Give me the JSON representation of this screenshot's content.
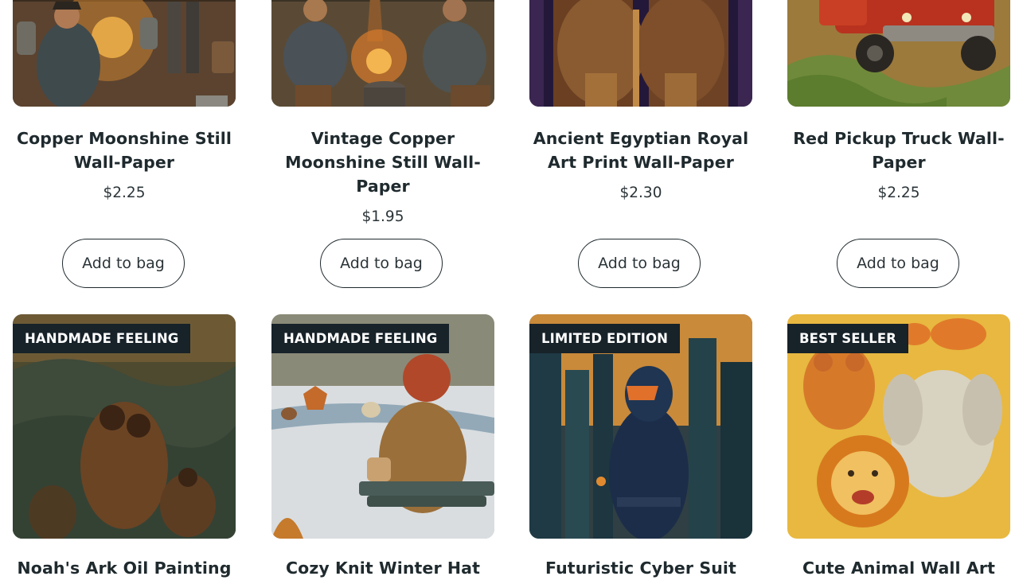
{
  "products_row1": [
    {
      "title": "Copper Moonshine Still Wall-Paper",
      "price": "$2.25",
      "button": "Add to bag"
    },
    {
      "title": "Vintage Copper Moonshine Still Wall-Paper",
      "price": "$1.95",
      "button": "Add to bag"
    },
    {
      "title": "Ancient Egyptian Royal Art Print Wall-Paper",
      "price": "$2.30",
      "button": "Add to bag"
    },
    {
      "title": "Red Pickup Truck Wall-Paper",
      "price": "$2.25",
      "button": "Add to bag"
    }
  ],
  "products_row2": [
    {
      "badge": "HANDMADE FEELING",
      "title": "Noah's Ark Oil Painting"
    },
    {
      "badge": "HANDMADE FEELING",
      "title": "Cozy Knit Winter Hat"
    },
    {
      "badge": "LIMITED EDITION",
      "title": "Futuristic Cyber Suit"
    },
    {
      "badge": "BEST SELLER",
      "title": "Cute Animal Wall Art"
    }
  ]
}
